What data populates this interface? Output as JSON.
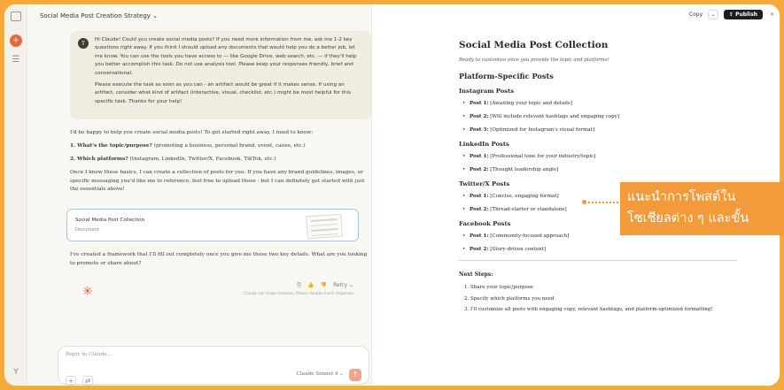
{
  "header": {
    "title": "Social Media Post Creation Strategy ⌄"
  },
  "rail": {
    "new_icon": "+",
    "chats_icon": "☰",
    "user_icon": "Y"
  },
  "user_message": {
    "avatar": "T",
    "p1": "Hi Claude! Could you create social media posts? If you need more information from me, ask me 1-2 key questions right away. If you think I should upload any documents that would help you do a better job, let me know. You can use the tools you have access to — like Google Drive, web search, etc. — if they'll help you better accomplish this task. Do not use analysis tool. Please keep your responses friendly, brief and conversational.",
    "p2": "Please execute the task as soon as you can - an artifact would be great if it makes sense. If using an artifact, consider what kind of artifact (interactive, visual, checklist, etc.) might be most helpful for this specific task. Thanks for your help!"
  },
  "assistant": {
    "intro": "I'd be happy to help you create social media posts! To get started right away, I need to know:",
    "q1_label": "1. What's the topic/purpose?",
    "q1_text": " (promoting a business, personal brand, event, cause, etc.)",
    "q2_label": "2. Which platforms?",
    "q2_text": " (Instagram, LinkedIn, Twitter/X, Facebook, TikTok, etc.)",
    "followup": "Once I know these basics, I can create a collection of posts for you. If you have any brand guidelines, images, or specific messaging you'd like me to reference, feel free to upload those - but I can definitely get started with just the essentials above!",
    "outro": "I've created a framework that I'll fill out completely once you give me those two key details. What are you looking to promote or share about?",
    "actions": {
      "copy": "⎘",
      "like": "👍",
      "dislike": "👎",
      "retry": "Retry ⌄"
    },
    "disclaimer": "Claude can make mistakes. Please double-check responses."
  },
  "artifact_card": {
    "title": "Social Media Post Collection",
    "subtitle": "Document"
  },
  "composer": {
    "placeholder": "Reply to Claude...",
    "attach": "+",
    "tools": "⇄",
    "model": "Claude Sonnet 4 ⌄",
    "send": "↑"
  },
  "artifact_toolbar": {
    "copy": "Copy",
    "chevron": "⌄",
    "publish": "⇪ Publish",
    "close": "✕"
  },
  "doc": {
    "title": "Social Media Post Collection",
    "intro": "Ready to customize once you provide the topic and platforms!",
    "platform_heading": "Platform-Specific Posts",
    "sections": [
      {
        "heading": "Instagram Posts",
        "items": [
          {
            "label": "Post 1:",
            "text": " [Awaiting your topic and details]"
          },
          {
            "label": "Post 2:",
            "text": " [Will include relevant hashtags and engaging copy]"
          },
          {
            "label": "Post 3:",
            "text": " [Optimized for Instagram's visual format]"
          }
        ]
      },
      {
        "heading": "LinkedIn Posts",
        "items": [
          {
            "label": "Post 1:",
            "text": " [Professional tone for your industry/topic]"
          },
          {
            "label": "Post 2:",
            "text": " [Thought leadership angle]"
          }
        ]
      },
      {
        "heading": "Twitter/X Posts",
        "items": [
          {
            "label": "Post 1:",
            "text": " [Concise, engaging format]"
          },
          {
            "label": "Post 2:",
            "text": " [Thread-starter or standalone]"
          }
        ]
      },
      {
        "heading": "Facebook Posts",
        "items": [
          {
            "label": "Post 1:",
            "text": " [Community-focused approach]"
          },
          {
            "label": "Post 2:",
            "text": " [Story-driven content]"
          }
        ]
      }
    ],
    "next_steps_heading": "Next Steps:",
    "next_steps": [
      "1. Share your topic/purpose",
      "2. Specify which platforms you need",
      "3. I'll customize all posts with engaging copy, relevant hashtags, and platform-optimized formatting!"
    ]
  },
  "callout": {
    "line1": "แนะนำการโพสต์ใน",
    "line2": "โซเชียลต่าง ๆ และขั้น"
  },
  "colors": {
    "frame": "#f4a93a",
    "accent": "#d9653d",
    "callout": "#f39a3b"
  }
}
